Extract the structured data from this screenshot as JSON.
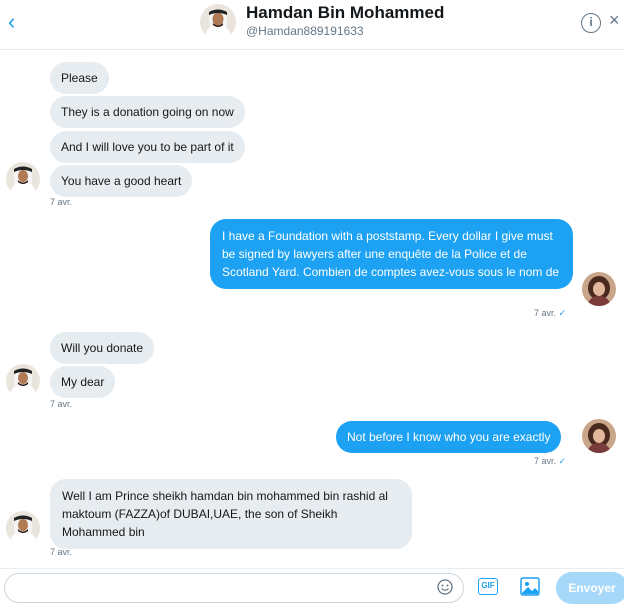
{
  "header": {
    "back_glyph": "‹",
    "name": "Hamdan Bin Mohammed",
    "handle": "@Hamdan889191633",
    "info_glyph": "i",
    "close_glyph": "×"
  },
  "messages": [
    {
      "side": "in",
      "text": "Please"
    },
    {
      "side": "in",
      "text": "They is a donation going on now"
    },
    {
      "side": "in",
      "text": "And I will love you to be part of it"
    },
    {
      "side": "in",
      "text": "You have a good heart"
    },
    {
      "side": "out",
      "text": "I have a Foundation with a poststamp. Every dollar I give must be signed by lawyers after une enquête de la Police et de Scotland Yard. Combien de comptes avez-vous sous le nom de"
    },
    {
      "side": "in",
      "text": "Will you donate"
    },
    {
      "side": "in",
      "text": "My dear"
    },
    {
      "side": "out",
      "text": "Not before I know who you are exactly"
    },
    {
      "side": "in",
      "text": "Well I am Prince sheikh hamdan bin mohammed bin rashid al maktoum (FAZZA)of DUBAI,UAE, the son of Sheikh Mohammed bin"
    }
  ],
  "timestamps": {
    "t1": "7 avr.",
    "t2": "7 avr.",
    "t3": "7 avr.",
    "t4": "7 avr.",
    "t5": "7 avr."
  },
  "read_check": "✓",
  "composer": {
    "placeholder": "",
    "emoji_icon": "emoji-icon",
    "gif_label": "GIF",
    "image_icon": "image-icon",
    "send_label": "Envoyer"
  },
  "colors": {
    "accent": "#1da1f2",
    "incoming_bubble": "#e6ecf0",
    "send_disabled": "#a5d8f9"
  }
}
